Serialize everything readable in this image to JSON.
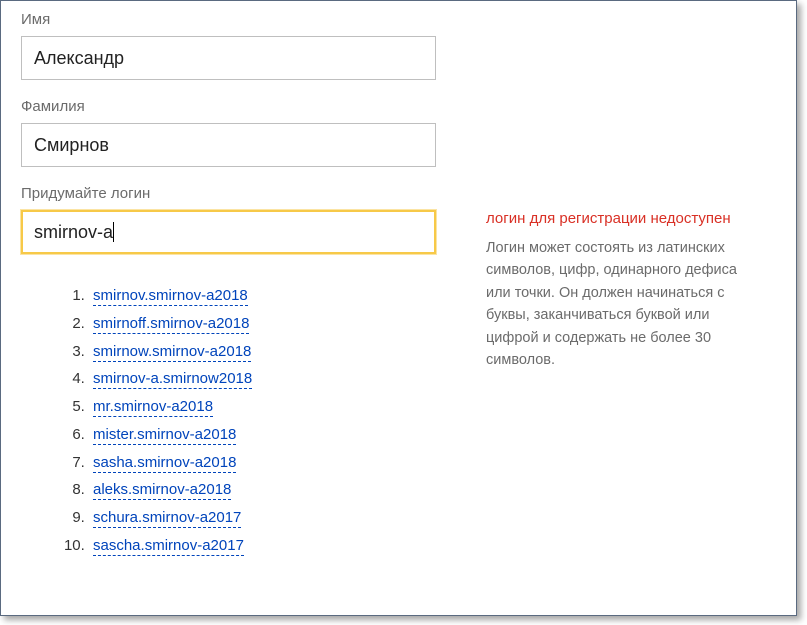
{
  "firstName": {
    "label": "Имя",
    "value": "Александр"
  },
  "lastName": {
    "label": "Фамилия",
    "value": "Смирнов"
  },
  "login": {
    "label": "Придумайте логин",
    "value": "smirnov-a"
  },
  "error": {
    "title": "логин для регистрации недоступен",
    "hint": "Логин может состоять из латинских символов, цифр, одинарного дефиса или точки. Он должен начинаться с буквы, заканчиваться буквой или цифрой и содержать не более 30 символов."
  },
  "suggestions": [
    "smirnov.smirnov-a2018",
    "smirnoff.smirnov-a2018",
    "smirnow.smirnov-a2018",
    "smirnov-a.smirnow2018",
    "mr.smirnov-a2018",
    "mister.smirnov-a2018",
    "sasha.smirnov-a2018",
    "aleks.smirnov-a2018",
    "schura.smirnov-a2017",
    "sascha.smirnov-a2017"
  ]
}
